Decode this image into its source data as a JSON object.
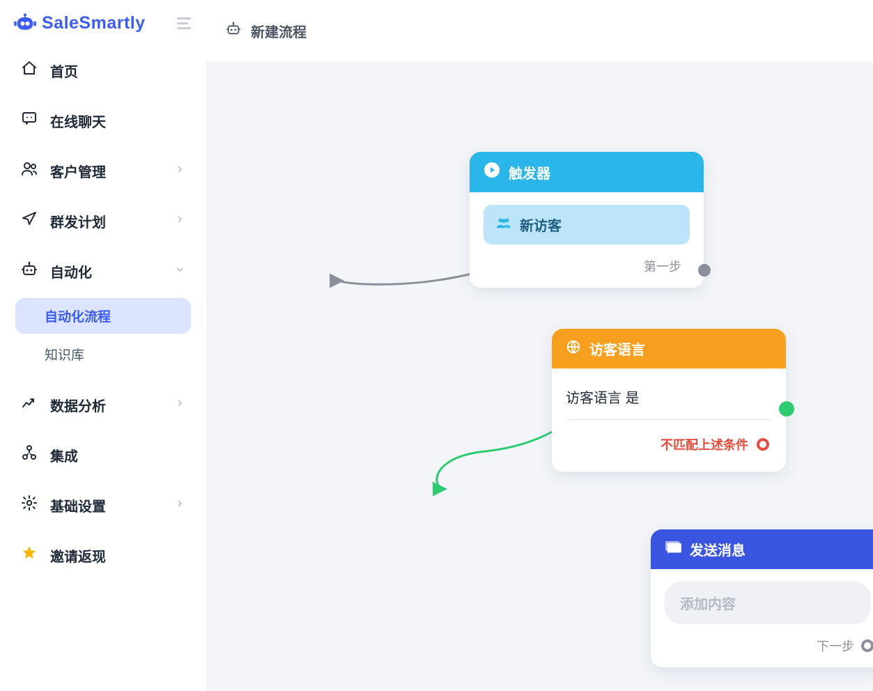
{
  "brand": {
    "name": "SaleSmartly"
  },
  "sidebar": {
    "items": [
      {
        "icon": "home",
        "label": "首页",
        "expandable": false
      },
      {
        "icon": "chat",
        "label": "在线聊天",
        "expandable": false
      },
      {
        "icon": "users",
        "label": "客户管理",
        "expandable": true,
        "expanded": false
      },
      {
        "icon": "send",
        "label": "群发计划",
        "expandable": true,
        "expanded": false
      },
      {
        "icon": "robot",
        "label": "自动化",
        "expandable": true,
        "expanded": true,
        "children": [
          {
            "label": "自动化流程",
            "active": true
          },
          {
            "label": "知识库",
            "active": false
          }
        ]
      },
      {
        "icon": "chart",
        "label": "数据分析",
        "expandable": true,
        "expanded": false
      },
      {
        "icon": "integration",
        "label": "集成",
        "expandable": false
      },
      {
        "icon": "settings",
        "label": "基础设置",
        "expandable": true,
        "expanded": false
      },
      {
        "icon": "star",
        "label": "邀请返现",
        "expandable": false,
        "highlight": true
      }
    ]
  },
  "topbar": {
    "title": "新建流程"
  },
  "flow": {
    "trigger": {
      "header": "触发器",
      "pill": "新访客",
      "footer": "第一步"
    },
    "condition": {
      "header": "访客语言",
      "predicate": "访客语言 是",
      "mismatch": "不匹配上述条件"
    },
    "action": {
      "header": "发送消息",
      "placeholder": "添加内容",
      "footer": "下一步"
    }
  },
  "colors": {
    "brand": "#3B5DF5",
    "teal": "#2AB6E9",
    "orange": "#F79F1F",
    "green": "#2ECC71",
    "red": "#E74C3C",
    "muted": "#8A8F99"
  }
}
